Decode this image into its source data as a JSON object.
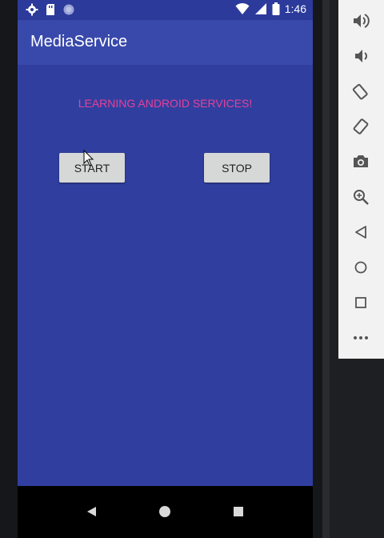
{
  "status_bar": {
    "time": "1:46",
    "icons": [
      "gear-icon",
      "sd-card-icon",
      "sync-icon",
      "wifi-icon",
      "signal-icon",
      "battery-icon"
    ]
  },
  "app": {
    "title": "MediaService",
    "headline": "LEARNING ANDROID SERVICES!",
    "start_label": "START",
    "stop_label": "STOP"
  },
  "nav_bar": {
    "icons": [
      "back-icon",
      "home-icon",
      "recents-icon"
    ]
  },
  "emulator_toolbar": {
    "icons": [
      "volume-up-icon",
      "volume-down-icon",
      "rotate-left-icon",
      "rotate-right-icon",
      "camera-icon",
      "zoom-icon",
      "back-icon",
      "home-icon",
      "overview-icon",
      "more-icon"
    ]
  },
  "colors": {
    "primary": "#3949ab",
    "primary_dark": "#2c3a9b",
    "content_bg": "#303f9f",
    "accent_text": "#e6409a",
    "button": "#d6d7d7"
  }
}
